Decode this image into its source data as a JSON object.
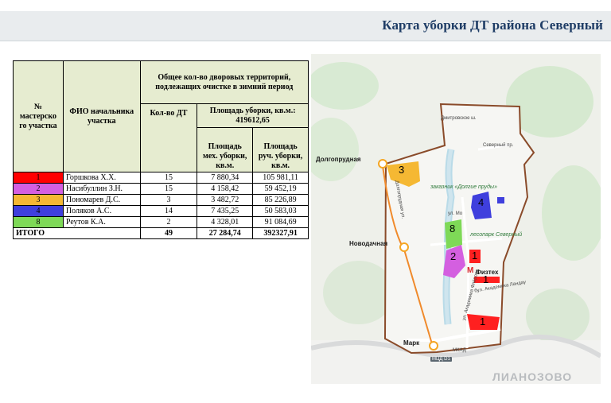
{
  "header": {
    "title": "Карта уборки ДТ района Северный"
  },
  "table": {
    "col_num": "№ мастерско го участка",
    "col_fio": "ФИО начальника участка",
    "group_header": "Общее кол-во дворовых территорий, подлежащих очистке в зимний период",
    "col_count": "Кол-во ДТ",
    "area_header": "Площадь уборки, кв.м.: 419612,65",
    "col_mech": "Площадь мех. уборки, кв.м.",
    "col_manual": "Площадь руч. уборки, кв.м.",
    "rows": [
      {
        "num": "1",
        "color": "#ff0000",
        "name": "Горшкова Х.Х.",
        "count": "15",
        "mech": "7 880,34",
        "manual": "105 981,11"
      },
      {
        "num": "2",
        "color": "#d45fe0",
        "name": "Насибуллин З.Н.",
        "count": "15",
        "mech": "4 158,42",
        "manual": "59 452,19"
      },
      {
        "num": "3",
        "color": "#f5b833",
        "name": "Пономарев Д.С.",
        "count": "3",
        "mech": "3 482,72",
        "manual": "85 226,89"
      },
      {
        "num": "4",
        "color": "#3f3fdd",
        "name": "Поляков А.С.",
        "count": "14",
        "mech": "7 435,25",
        "manual": "50 583,03"
      },
      {
        "num": "8",
        "color": "#7ed957",
        "name": "Реутов К.А.",
        "count": "2",
        "mech": "4 328,01",
        "manual": "91 084,69"
      }
    ],
    "total": {
      "label": "ИТОГО",
      "count": "49",
      "mech": "27 284,74",
      "manual": "392327,91"
    }
  },
  "map": {
    "stations": [
      "Долгопрудная",
      "Новодачная",
      "Марк"
    ],
    "zone_labels": [
      "3",
      "4",
      "8",
      "2",
      "1",
      "1",
      "1",
      "1"
    ],
    "reserve": "заказник «Долгие пруды»",
    "forest": "лесопарк Северный",
    "fiztech": "Физтех",
    "metro_letter": "М",
    "streets": [
      "Дмитровское ш.",
      "Долгопрудная ул.",
      "ул. Академика Флёрова",
      "бул. Академика Ландау",
      "ул. Мо",
      "Северный пр.",
      "МКАД"
    ],
    "mcd_badge": "МЦД D1",
    "district": "ЛИАНОЗОВО"
  }
}
